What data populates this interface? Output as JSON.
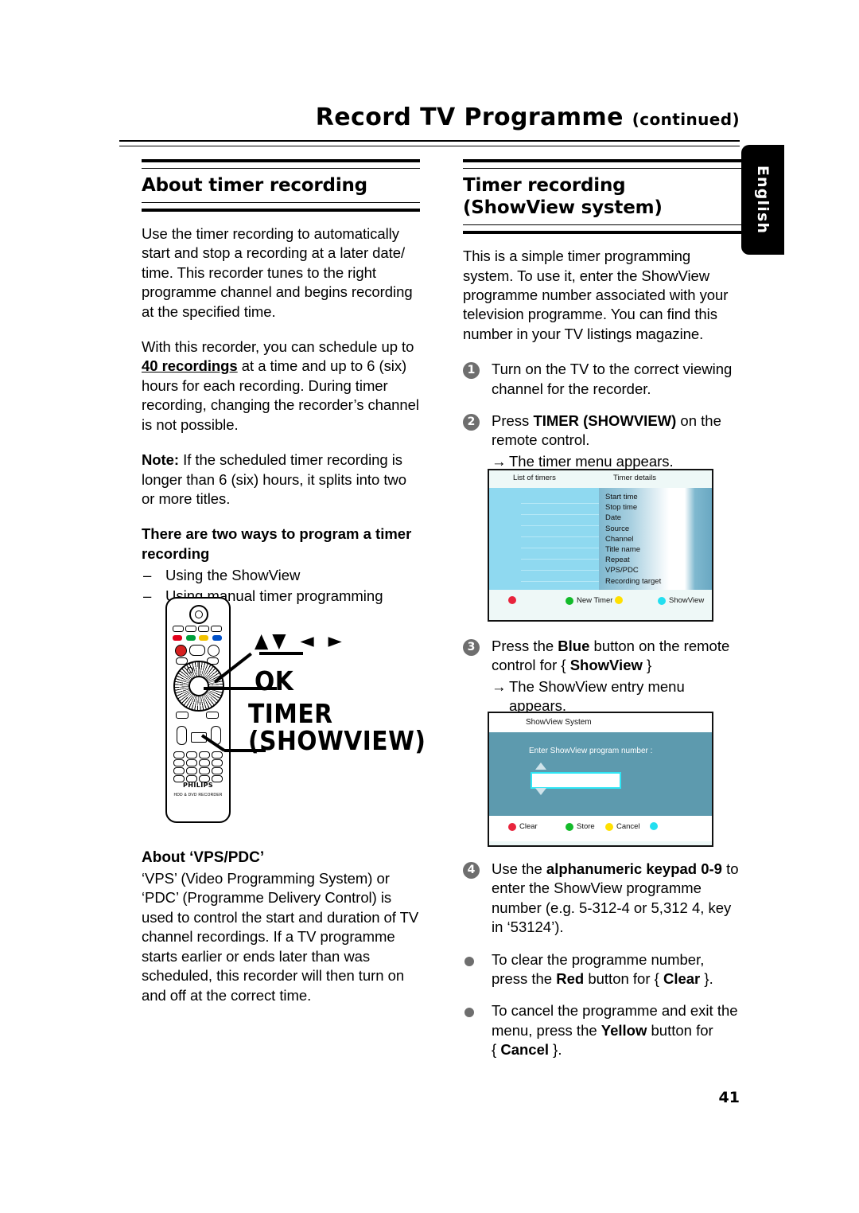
{
  "header": {
    "title": "Record TV Programme",
    "continued": "(continued)"
  },
  "lang_tab": {
    "label": "English"
  },
  "page_number": "41",
  "left_column": {
    "heading": "About timer recording",
    "para1": "Use the timer recording to automatically start and stop a recording at a later date/ time. This recorder tunes to the right programme channel and begins recording at the specified time.",
    "para2_a": "With this recorder, you can schedule up to ",
    "para2_bold": "40 recordings",
    "para2_b": " at a time and up to 6 (six) hours for each recording.  During timer recording, changing the recorder’s channel is not possible.",
    "note_label": "Note:",
    "note_text": "  If the scheduled timer recording is longer than 6 (six) hours, it splits into two or more titles.",
    "subheading": "There are two ways to program a timer recording",
    "bullets": [
      "Using the ShowView",
      "Using manual timer programming"
    ],
    "vps_heading": "About ‘VPS/PDC’",
    "vps_text": "‘VPS’ (Video Programming System) or ‘PDC’ (Programme Delivery Control) is used to control the start and duration of TV channel recordings. If a TV programme starts earlier or ends later than was scheduled, this recorder will then turn on and off at the correct time."
  },
  "remote": {
    "callout_arrows": "▲▼ ◄ ►",
    "callout_ok": "OK",
    "callout_timer_line1": "TIMER",
    "callout_timer_line2": "(SHOWVIEW)",
    "brand": "PHILIPS",
    "model": "HDD & DVD RECORDER"
  },
  "right_column": {
    "heading": "Timer recording (ShowView system)",
    "intro": "This is a simple timer programming system. To use it, enter the ShowView programme number associated with your television programme. You can find this number in your TV listings magazine.",
    "step1_num": "1",
    "step1_text": "Turn on the TV to the correct viewing channel for the recorder.",
    "step2_num": "2",
    "step2_a": "Press ",
    "step2_bold": "TIMER (SHOWVIEW)",
    "step2_b": " on the remote control.",
    "step2_result": "The timer menu appears.",
    "step3_num": "3",
    "step3_a": "Press the ",
    "step3_bold1": "Blue",
    "step3_b": " button on the remote control for { ",
    "step3_bold2": "ShowView",
    "step3_c": " }",
    "step3_result": "The ShowView entry menu appears.",
    "step4_num": "4",
    "step4_a": "Use the ",
    "step4_bold": "alphanumeric keypad 0-9",
    "step4_b": " to enter the ShowView programme number (e.g. 5-312-4 or 5,312 4, key in ‘53124’).",
    "bullet1_a": "To clear the programme number, press the ",
    "bullet1_bold1": "Red",
    "bullet1_b": " button for { ",
    "bullet1_bold2": "Clear",
    "bullet1_c": " }.",
    "bullet2_a": "To cancel the programme and exit the menu, press the ",
    "bullet2_bold1": "Yellow",
    "bullet2_b": " button for ",
    "bullet2_c": "{ ",
    "bullet2_bold2": "Cancel",
    "bullet2_d": " }."
  },
  "timer_screenshot": {
    "col_list": "List of timers",
    "col_details": "Timer details",
    "detail_items": [
      "Start time",
      "Stop time",
      "Date",
      "Source",
      "Channel",
      "Title name",
      "Repeat",
      "VPS/PDC",
      "Recording target"
    ],
    "buttons": [
      {
        "color": "red",
        "label": ""
      },
      {
        "color": "grn",
        "label": "New Timer"
      },
      {
        "color": "yel",
        "label": ""
      },
      {
        "color": "cyan",
        "label": "ShowView"
      }
    ]
  },
  "showview_screenshot": {
    "title": "ShowView System",
    "prompt": "Enter ShowView program number :",
    "field_value": "",
    "buttons": [
      {
        "color": "red",
        "label": "Clear"
      },
      {
        "color": "grn",
        "label": "Store"
      },
      {
        "color": "yel",
        "label": "Cancel"
      },
      {
        "color": "cyan",
        "label": ""
      }
    ]
  },
  "colors": {
    "red": "#e8243c",
    "green": "#13bb2a",
    "yellow": "#ffe000",
    "cyan": "#22dff0",
    "timer_menu_bg": "#8fd9f0",
    "showview_bg": "#5d9aae"
  }
}
